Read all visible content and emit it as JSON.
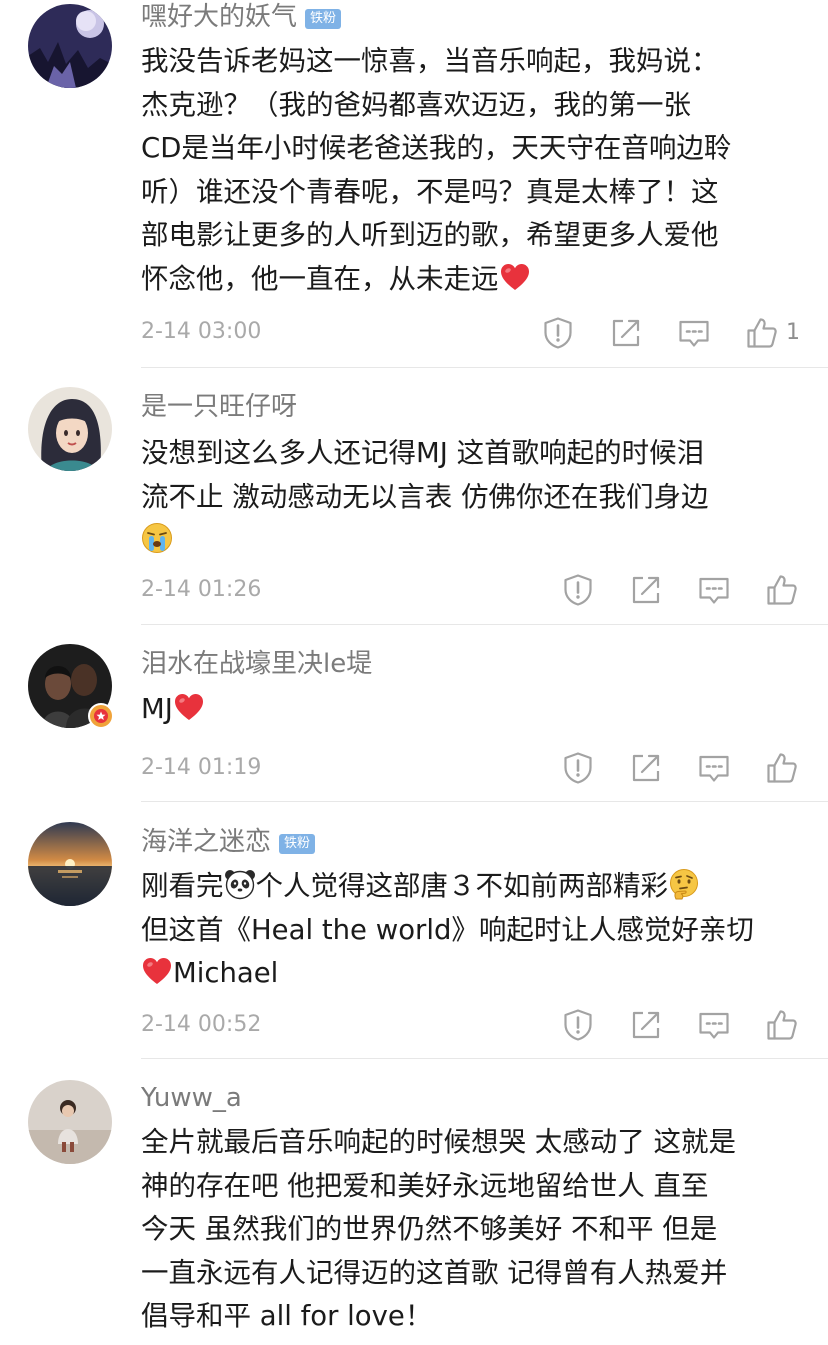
{
  "comments": [
    {
      "author": "嘿好大的妖气",
      "badge": "铁粉",
      "lines": [
        "我没告诉老妈这一惊喜，当音乐响起，我妈说：",
        "杰克逊？（我的爸妈都喜欢迈迈，我的第一张",
        "CD是当年小时候老爸送我的，天天守在音响边聆",
        "听）谁还没个青春呢，不是吗？真是太棒了！这",
        "部电影让更多的人听到迈的歌，希望更多人爱他",
        "怀念他，他一直在，从未走远"
      ],
      "time": "2-14 03:00",
      "likes": "1"
    },
    {
      "author": "是一只旺仔呀",
      "lines": [
        "没想到这么多人还记得MJ 这首歌响起的时候泪",
        "流不止 激动感动无以言表 仿佛你还在我们身边"
      ],
      "time": "2-14 01:26"
    },
    {
      "author": "泪水在战壕里决le堤",
      "text": "MJ",
      "time": "2-14 01:19"
    },
    {
      "author": "海洋之迷恋",
      "badge": "铁粉",
      "line1a": "刚看完",
      "line1b": "个人觉得这部唐３不如前两部精彩",
      "line2": "但这首《Heal the world》响起时让人感觉好亲切",
      "line3": "Michael",
      "time": "2-14 00:52"
    },
    {
      "author": "Yuww_a",
      "lines": [
        "全片就最后音乐响起的时候想哭 太感动了 这就是",
        "神的存在吧 他把爱和美好永远地留给世人 直至",
        "今天 虽然我们的世界仍然不够美好 不和平 但是",
        "一直永远有人记得迈的这首歌 记得曾有人热爱并",
        "倡导和平 all for love！"
      ]
    }
  ],
  "icons": {
    "report": "report-icon",
    "share": "share-icon",
    "reply": "comment-icon",
    "like": "like-icon",
    "heart": "red-heart-emoji",
    "crying": "crying-emoji",
    "panda": "panda-emoji",
    "thinking": "thinking-emoji"
  },
  "colors": {
    "heart": "#e8323c",
    "badge": "#7fb2e6",
    "meta": "#a9a9a9"
  }
}
